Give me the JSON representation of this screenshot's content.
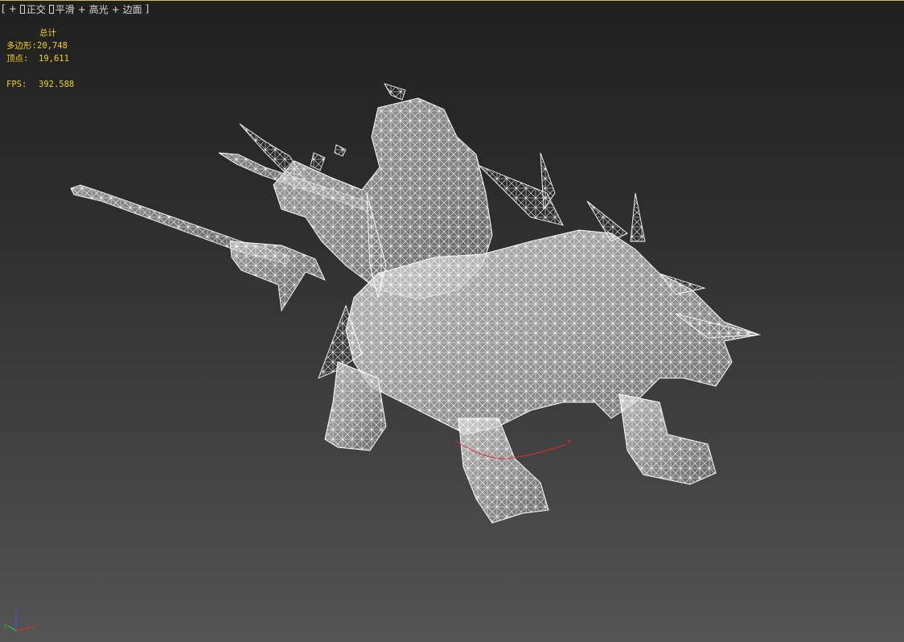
{
  "viewport_menu": {
    "plus": "+",
    "view": "正交",
    "shading": "平滑",
    "highlight_plus": "+",
    "highlight": "高光",
    "edges_plus": "+",
    "edges": "边面"
  },
  "stats": {
    "header": "总计",
    "polygons_label": "多边形:",
    "polygons_value": "20,748",
    "vertices_label": "顶点:",
    "vertices_value": "19,611",
    "fps_label": "FPS:",
    "fps_value": "392.588"
  },
  "axis": {
    "z": "z",
    "y": "y",
    "x": "x"
  },
  "transform_axis_label": "x",
  "colors": {
    "stats_text": "#f0d020",
    "wire": "#ffffff",
    "surface": "#c8c8c8",
    "axis_x": "#e03030",
    "axis_y": "#30c030",
    "axis_z": "#3060e0",
    "viewport_border": "#d9b84a"
  }
}
